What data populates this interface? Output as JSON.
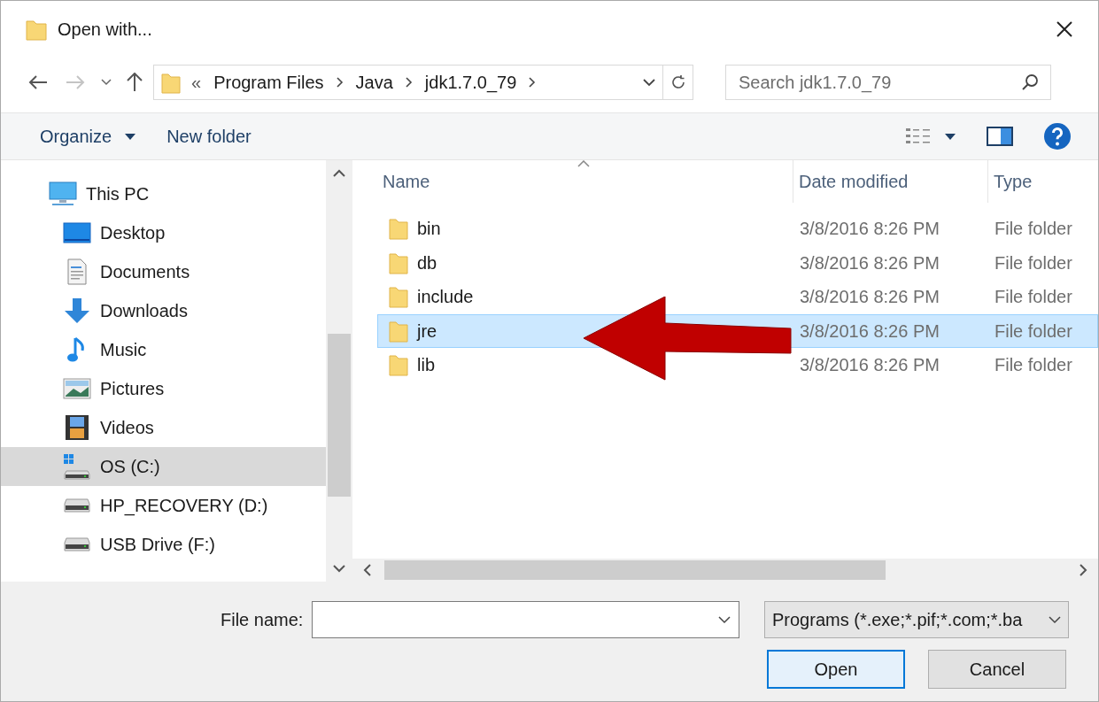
{
  "window": {
    "title": "Open with..."
  },
  "address_bar": {
    "overflow": "«",
    "crumbs": [
      "Program Files",
      "Java",
      "jdk1.7.0_79"
    ]
  },
  "search": {
    "placeholder": "Search jdk1.7.0_79"
  },
  "toolbar": {
    "organize": "Organize",
    "new_folder": "New folder"
  },
  "sidebar": {
    "items": [
      {
        "label": "This PC",
        "kind": "pc",
        "selected": false,
        "children": [
          {
            "label": "Desktop",
            "kind": "desktop",
            "selected": false
          },
          {
            "label": "Documents",
            "kind": "documents",
            "selected": false
          },
          {
            "label": "Downloads",
            "kind": "downloads",
            "selected": false
          },
          {
            "label": "Music",
            "kind": "music",
            "selected": false
          },
          {
            "label": "Pictures",
            "kind": "pictures",
            "selected": false
          },
          {
            "label": "Videos",
            "kind": "videos",
            "selected": false
          },
          {
            "label": "OS (C:)",
            "kind": "system_drive",
            "selected": true
          },
          {
            "label": "HP_RECOVERY (D:)",
            "kind": "drive",
            "selected": false
          },
          {
            "label": "USB Drive (F:)",
            "kind": "drive",
            "selected": false
          }
        ]
      }
    ]
  },
  "file_list": {
    "columns": [
      "Name",
      "Date modified",
      "Type"
    ],
    "rows": [
      {
        "name": "bin",
        "date": "3/8/2016 8:26 PM",
        "type": "File folder",
        "selected": false
      },
      {
        "name": "db",
        "date": "3/8/2016 8:26 PM",
        "type": "File folder",
        "selected": false
      },
      {
        "name": "include",
        "date": "3/8/2016 8:26 PM",
        "type": "File folder",
        "selected": false
      },
      {
        "name": "jre",
        "date": "3/8/2016 8:26 PM",
        "type": "File folder",
        "selected": true
      },
      {
        "name": "lib",
        "date": "3/8/2016 8:26 PM",
        "type": "File folder",
        "selected": false
      }
    ]
  },
  "file_name": {
    "label": "File name:"
  },
  "file_type": {
    "value": "Programs (*.exe;*.pif;*.com;*.ba"
  },
  "buttons": [
    {
      "label": "Open",
      "kind": "default"
    },
    {
      "label": "Cancel",
      "kind": "normal"
    }
  ]
}
